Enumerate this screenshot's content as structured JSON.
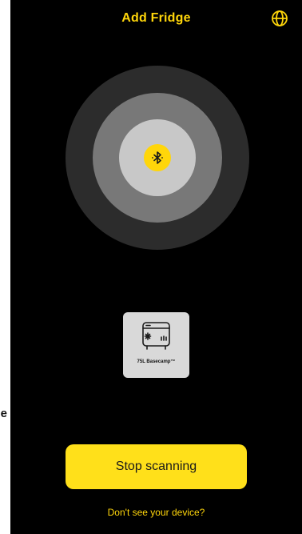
{
  "header": {
    "title": "Add Fridge",
    "globe_icon": "globe-icon"
  },
  "scanner": {
    "center_icon": "bluetooth-icon",
    "colors": {
      "outer_ring": "#2c2c2c",
      "middle_ring": "#787878",
      "inner_ring": "#c8c8c8",
      "badge": "#ffd60a"
    }
  },
  "devices": [
    {
      "name": "75L Basecamp™",
      "icon": "fridge-icon"
    }
  ],
  "side_fragment": "e",
  "actions": {
    "stop_label": "Stop scanning",
    "help_link": "Don't see your device?"
  },
  "colors": {
    "accent": "#ffd60a",
    "background": "#000000"
  }
}
